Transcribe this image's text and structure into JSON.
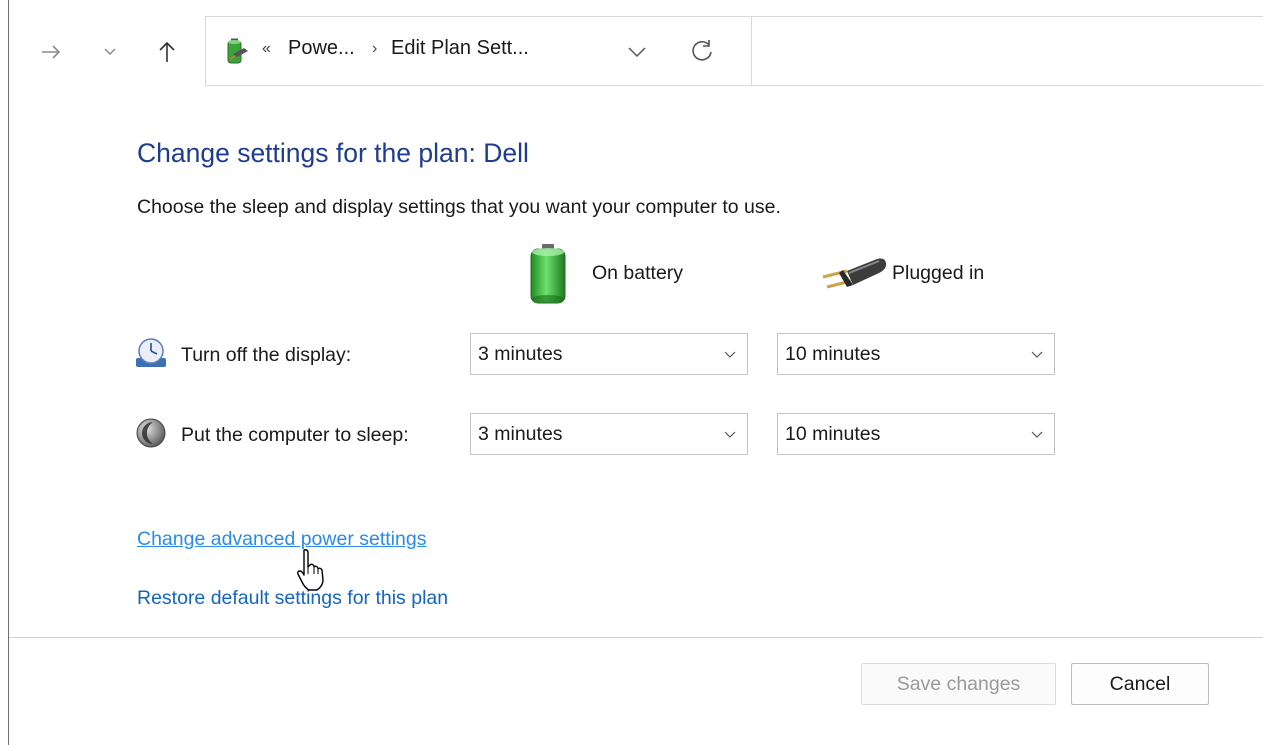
{
  "address_bar": {
    "crumb_separator_lead": "«",
    "crumb_1": "Powe...",
    "crumb_separator": "›",
    "crumb_2": "Edit Plan Sett..."
  },
  "page": {
    "title": "Change settings for the plan: Dell",
    "subtitle": "Choose the sleep and display settings that you want your computer to use."
  },
  "columns": {
    "on_battery": "On battery",
    "plugged_in": "Plugged in"
  },
  "settings": [
    {
      "label": "Turn off the display:",
      "on_battery": "3 minutes",
      "plugged_in": "10 minutes"
    },
    {
      "label": "Put the computer to sleep:",
      "on_battery": "3 minutes",
      "plugged_in": "10 minutes"
    }
  ],
  "links": {
    "advanced": "Change advanced power settings",
    "restore": "Restore default settings for this plan"
  },
  "buttons": {
    "save": "Save changes",
    "cancel": "Cancel"
  },
  "colors": {
    "title": "#1f3d8f",
    "link": "#1565c0",
    "link_hover": "#2a8be6"
  },
  "icons": {
    "forward": "arrow-right-icon",
    "recent": "chevron-down-icon",
    "up": "arrow-up-icon",
    "location": "power-options-icon",
    "refresh": "refresh-icon",
    "battery": "battery-icon",
    "plug": "power-plug-icon",
    "display": "display-timer-icon",
    "sleep": "sleep-moon-icon",
    "cursor": "hand-cursor-icon"
  }
}
